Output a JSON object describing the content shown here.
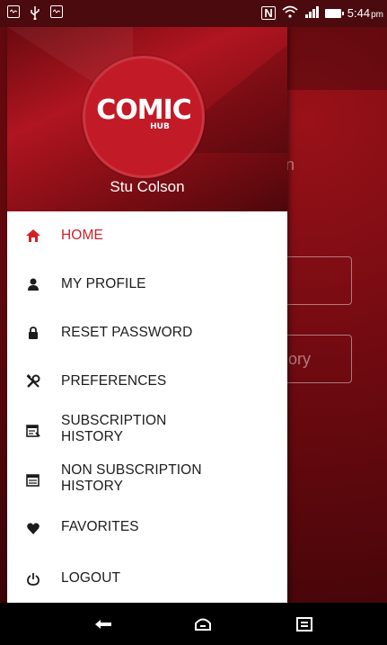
{
  "status_bar": {
    "time": "5:44",
    "time_suffix": "pm",
    "left_icons": [
      "screen-icon",
      "usb-icon",
      "screen-icon"
    ],
    "right_icons": [
      "nfc-icon",
      "wifi-icon",
      "signal-icon",
      "battery-icon"
    ]
  },
  "background": {
    "ghost_text_1": "n",
    "ghost_text_2": "ory"
  },
  "drawer": {
    "logo_text": "COMIC",
    "logo_subtext": "HUB",
    "user_name": "Stu Colson",
    "menu": [
      {
        "label": "HOME",
        "icon": "home-icon",
        "active": true
      },
      {
        "label": "MY PROFILE",
        "icon": "user-icon",
        "active": false
      },
      {
        "label": "RESET PASSWORD",
        "icon": "lock-icon",
        "active": false
      },
      {
        "label": "PREFERENCES",
        "icon": "tools-icon",
        "active": false
      },
      {
        "label": "SUBSCRIPTION HISTORY",
        "line1": "SUBSCRIPTION",
        "line2": "HISTORY",
        "icon": "receipt-icon",
        "active": false
      },
      {
        "label": "NON SUBSCRIPTION HISTORY",
        "line1": "NON SUBSCRIPTION",
        "line2": "HISTORY",
        "icon": "receipt-list-icon",
        "active": false
      },
      {
        "label": "FAVORITES",
        "icon": "heart-icon",
        "active": false
      },
      {
        "label": "LOGOUT",
        "icon": "power-icon",
        "active": false
      }
    ]
  },
  "nav_bar": {
    "buttons": [
      "back-icon",
      "home-icon",
      "recent-apps-icon"
    ]
  },
  "colors": {
    "accent": "#d0202a",
    "drawer_header": "#b01520",
    "text": "#1c1c1c"
  }
}
